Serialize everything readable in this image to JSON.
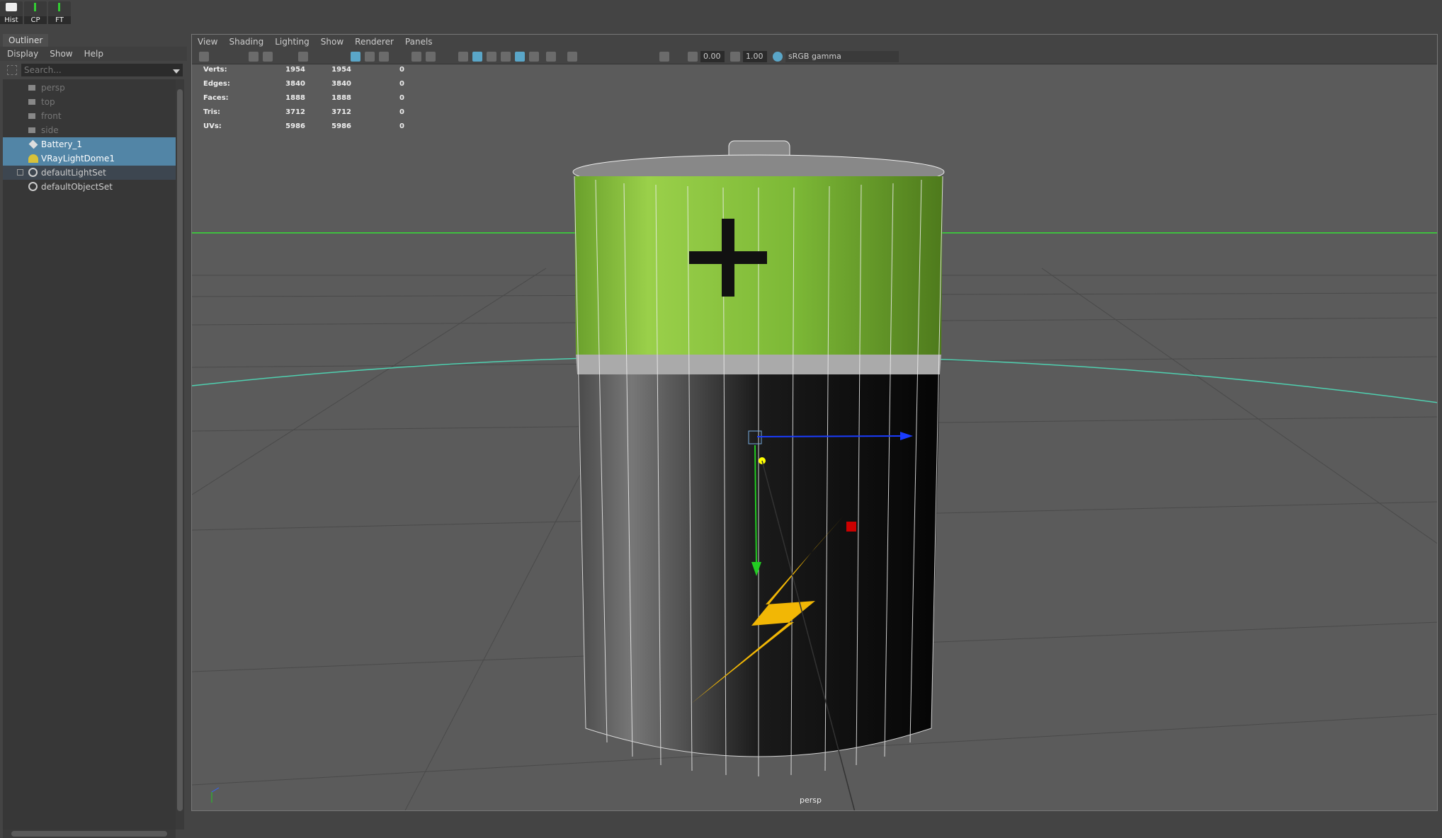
{
  "shelf": {
    "buttons": [
      {
        "label": "Hist",
        "icon": "history-pencil-icon"
      },
      {
        "label": "CP",
        "icon": "axis-icon"
      },
      {
        "label": "FT",
        "icon": "axis-icon"
      }
    ]
  },
  "outliner": {
    "tab": "Outliner",
    "menu": [
      "Display",
      "Show",
      "Help"
    ],
    "search_placeholder": "Search...",
    "items": [
      {
        "label": "persp",
        "icon": "camera-icon",
        "state": "dim"
      },
      {
        "label": "top",
        "icon": "camera-icon",
        "state": "dim"
      },
      {
        "label": "front",
        "icon": "camera-icon",
        "state": "dim"
      },
      {
        "label": "side",
        "icon": "camera-icon",
        "state": "dim"
      },
      {
        "label": "Battery_1",
        "icon": "mesh-icon",
        "state": "selected"
      },
      {
        "label": "VRayLightDome1",
        "icon": "dome-light-icon",
        "state": "selected"
      },
      {
        "label": "defaultLightSet",
        "icon": "set-icon",
        "state": "normal"
      },
      {
        "label": "defaultObjectSet",
        "icon": "set-icon",
        "state": "normal"
      }
    ]
  },
  "viewport": {
    "menu": [
      "View",
      "Shading",
      "Lighting",
      "Show",
      "Renderer",
      "Panels"
    ],
    "exposure": "0.00",
    "gamma": "1.00",
    "color_space": "sRGB gamma",
    "camera": "persp",
    "stats": [
      {
        "label": "Verts:",
        "a": "1954",
        "b": "1954",
        "c": "0"
      },
      {
        "label": "Edges:",
        "a": "3840",
        "b": "3840",
        "c": "0"
      },
      {
        "label": "Faces:",
        "a": "1888",
        "b": "1888",
        "c": "0"
      },
      {
        "label": "Tris:",
        "a": "3712",
        "b": "3712",
        "c": "0"
      },
      {
        "label": "UVs:",
        "a": "5986",
        "b": "5986",
        "c": "0"
      }
    ]
  },
  "colors": {
    "selection": "#5285a6",
    "battery_green": "#8cc63f",
    "bolt": "#f2b705"
  }
}
